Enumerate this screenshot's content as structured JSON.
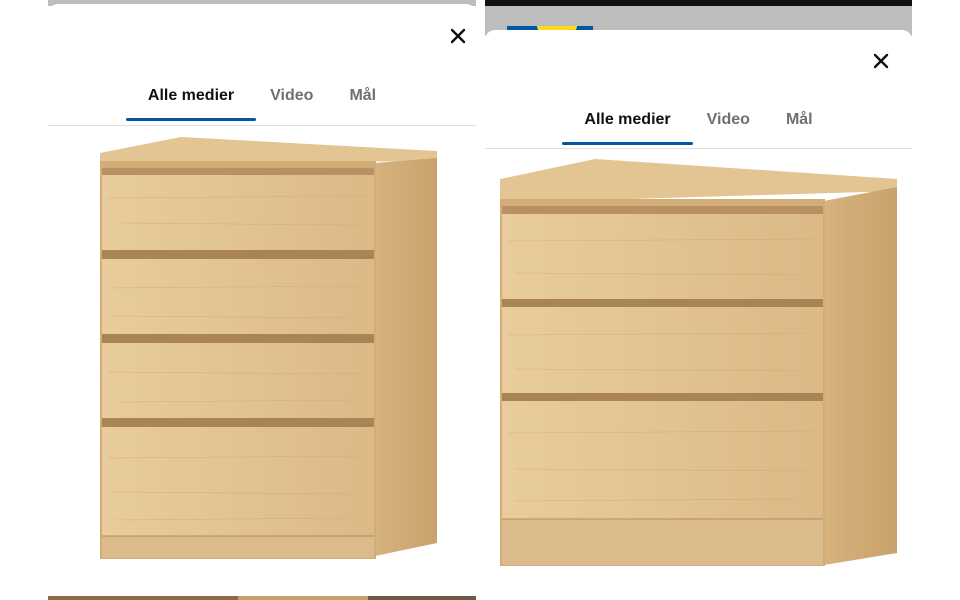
{
  "left_panel": {
    "tabs": [
      {
        "label": "Alle medier",
        "active": true
      },
      {
        "label": "Video",
        "active": false
      },
      {
        "label": "Mål",
        "active": false
      }
    ],
    "close_icon": "close-icon",
    "image": "4-drawer chest of drawers, white stained oak veneer"
  },
  "right_panel": {
    "tabs": [
      {
        "label": "Alle medier",
        "active": true
      },
      {
        "label": "Video",
        "active": false
      },
      {
        "label": "Mål",
        "active": false
      }
    ],
    "close_icon": "close-icon",
    "image": "3-drawer chest of drawers, white stained oak veneer"
  },
  "colors": {
    "accent": "#0058a3",
    "wood_light": "#e6c898",
    "wood_mid": "#d9b47f",
    "wood_dark": "#b8905d"
  }
}
